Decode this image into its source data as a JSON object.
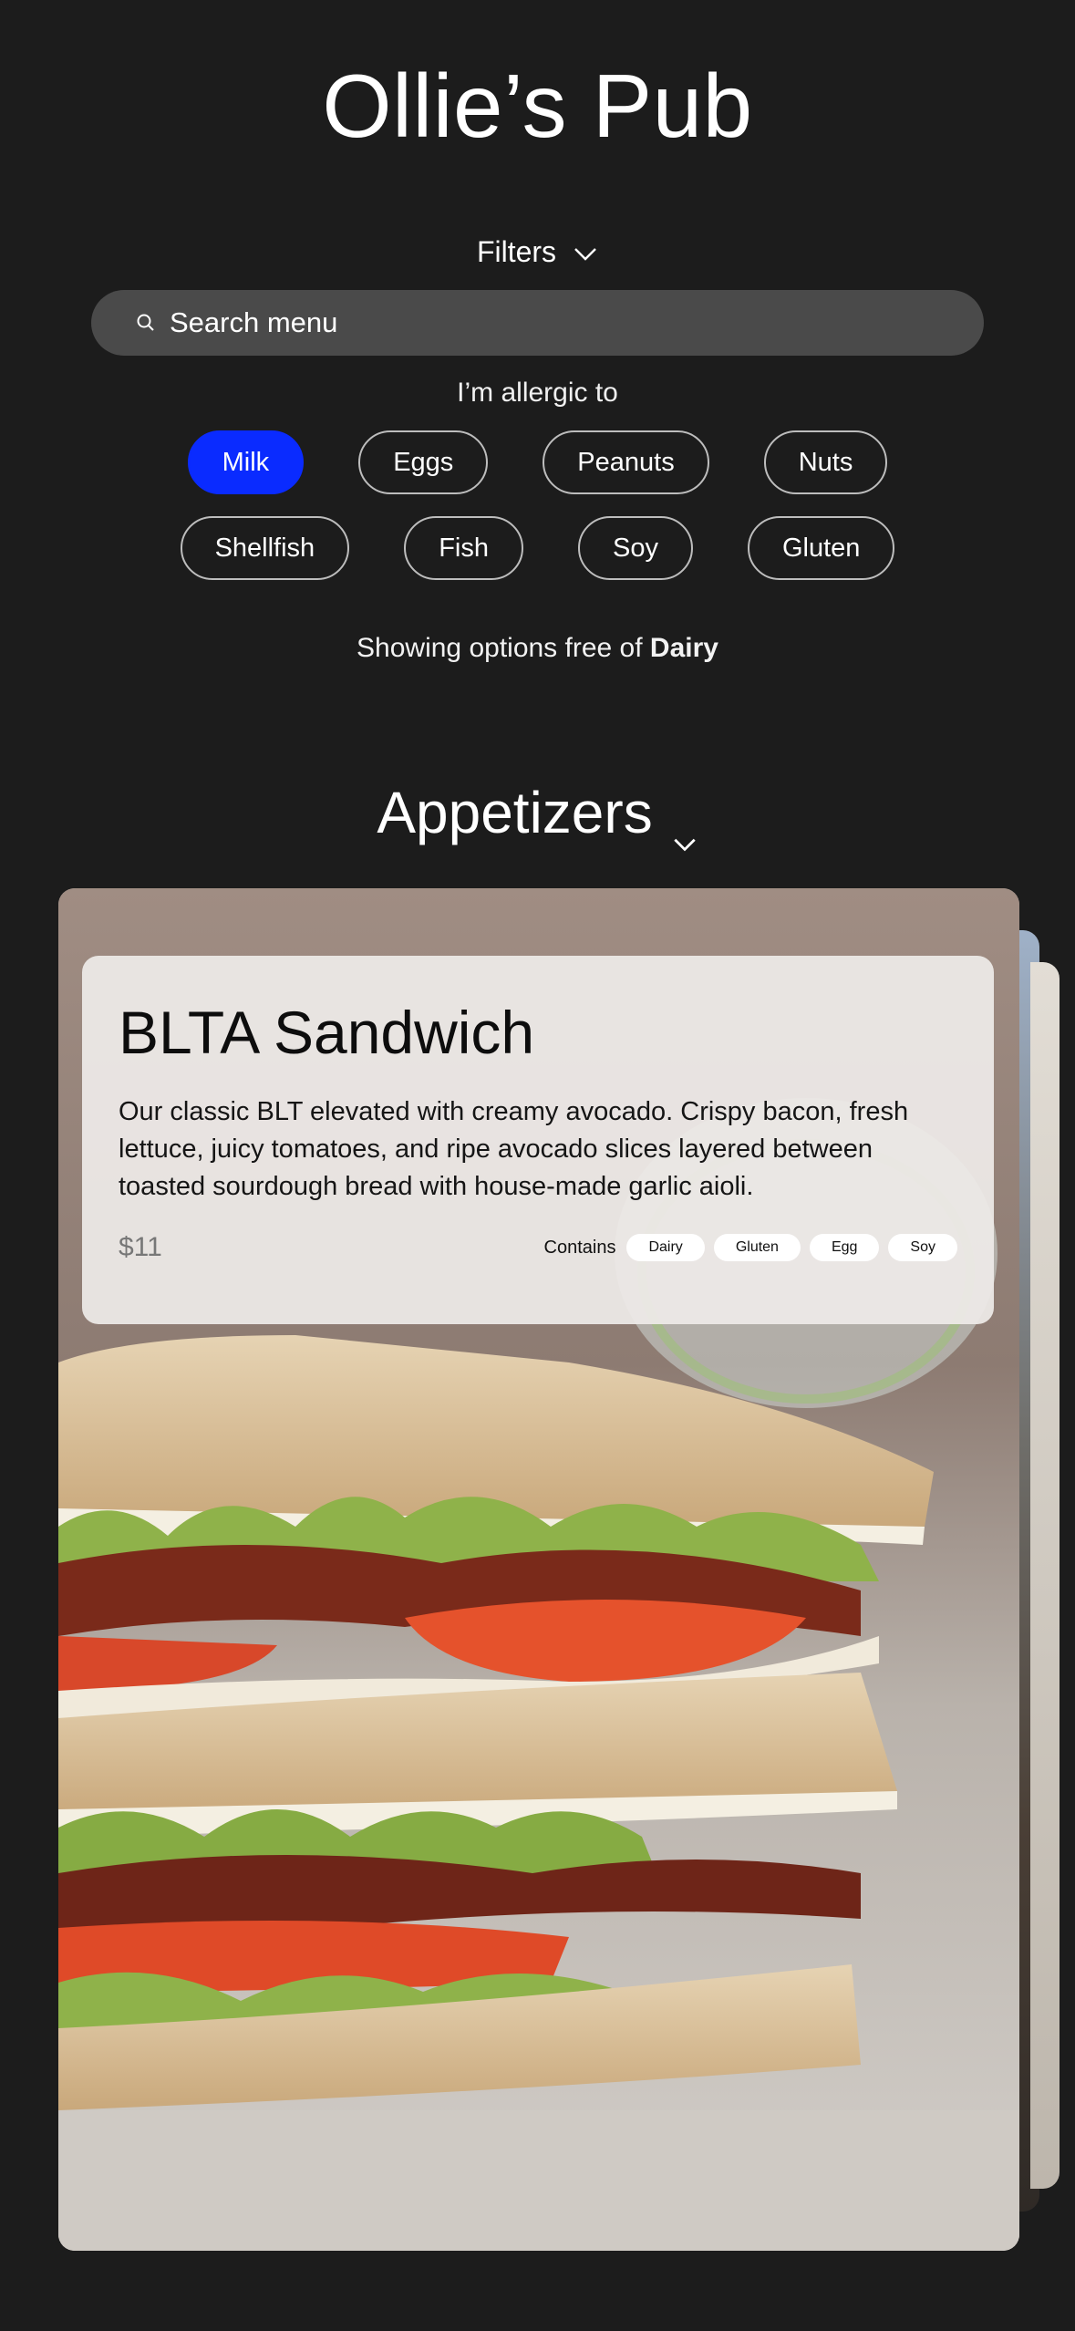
{
  "app": {
    "title": "Ollie’s Pub"
  },
  "filters": {
    "label": "Filters"
  },
  "search": {
    "placeholder": "Search menu"
  },
  "allergens": {
    "label": "I’m allergic to",
    "row1": [
      {
        "label": "Milk",
        "selected": true
      },
      {
        "label": "Eggs",
        "selected": false
      },
      {
        "label": "Peanuts",
        "selected": false
      },
      {
        "label": "Nuts",
        "selected": false
      }
    ],
    "row2": [
      {
        "label": "Shellfish",
        "selected": false
      },
      {
        "label": "Fish",
        "selected": false
      },
      {
        "label": "Soy",
        "selected": false
      },
      {
        "label": "Gluten",
        "selected": false
      }
    ],
    "selected_color": "#0a2bff"
  },
  "status": {
    "prefix": "Showing options free of ",
    "value": "Dairy"
  },
  "section": {
    "title": "Appetizers"
  },
  "item": {
    "name": "BLTA Sandwich",
    "description": "Our classic BLT elevated with creamy avocado. Crispy bacon, fresh lettuce, juicy tomatoes, and ripe avocado slices layered between toasted sourdough bread with house-made garlic aioli.",
    "price": "$11",
    "contains_label": "Contains",
    "contains": [
      "Dairy",
      "Gluten",
      "Egg",
      "Soy"
    ]
  }
}
